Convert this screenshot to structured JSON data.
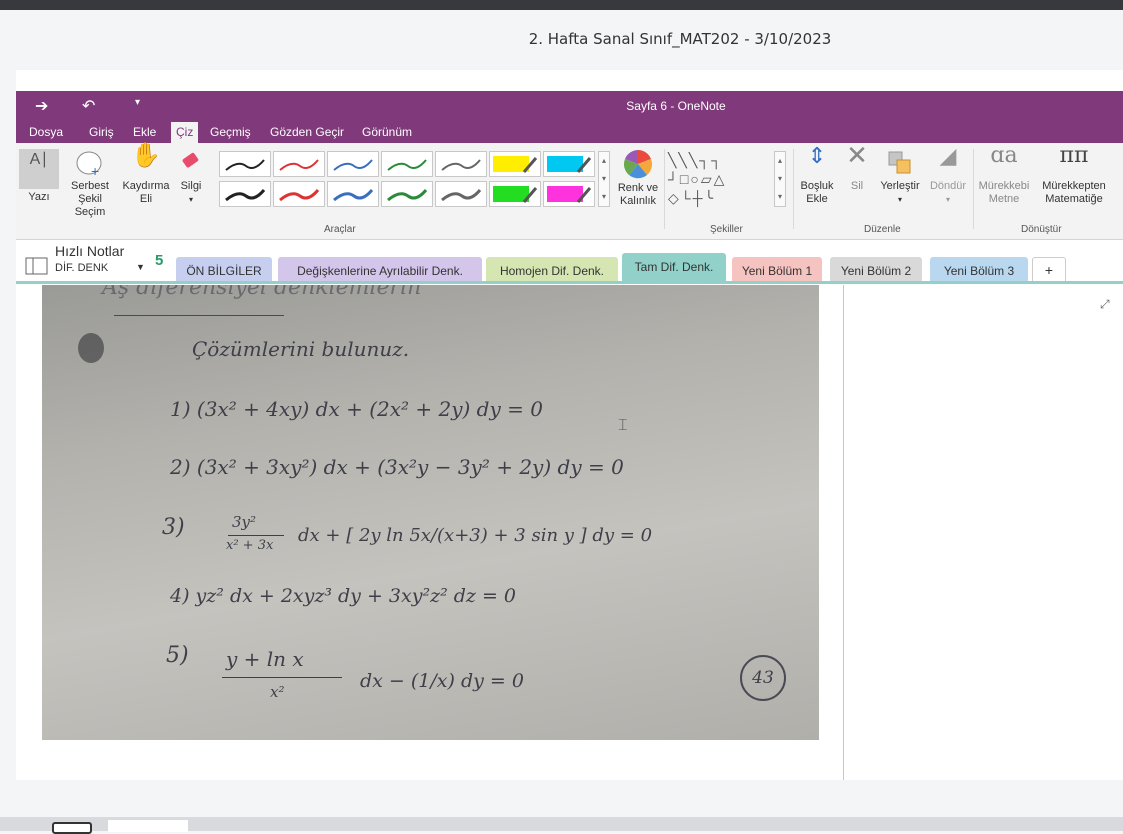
{
  "meeting": {
    "title": "2. Hafta Sanal Sınıf_MAT202 - 3/10/2023"
  },
  "window": {
    "title": "Sayfa 6 - OneNote"
  },
  "menu": [
    "Dosya",
    "Giriş",
    "Ekle",
    "Çiz",
    "Geçmiş",
    "Gözden Geçir",
    "Görünüm"
  ],
  "ribbon": {
    "yazi": "Yazı",
    "serbest_1": "Serbest",
    "serbest_2": "Şekil Seçim",
    "kaydirma_1": "Kaydırma",
    "kaydirma_2": "Eli",
    "silgi": "Silgi",
    "renk_1": "Renk ve",
    "renk_2": "Kalınlık",
    "bosluk_1": "Boşluk",
    "bosluk_2": "Ekle",
    "sil": "Sil",
    "yerlestir": "Yerleştir",
    "dondur": "Döndür",
    "murekkebi_1": "Mürekkebi",
    "murekkebi_2": "Metne",
    "murekkepten_1": "Mürekkepten",
    "murekkepten_2": "Matematiğe",
    "group_araclar": "Araçlar",
    "group_sekiller": "Şekiller",
    "group_duzenle": "Düzenle",
    "group_donustur": "Dönüştür"
  },
  "notebook": {
    "name": "Hızlı Notlar",
    "section": "DİF. DENK",
    "sync": "5"
  },
  "tabs": [
    {
      "label": "ÖN BİLGİLER",
      "color": "#c6cff0"
    },
    {
      "label": "Değişkenlerine Ayrılabilir Denk.",
      "color": "#d4c5ea"
    },
    {
      "label": "Homojen Dif. Denk.",
      "color": "#d5e6b3"
    },
    {
      "label": "Tam Dif. Denk.",
      "color": "#91d1c9"
    },
    {
      "label": "Yeni Bölüm 1",
      "color": "#f5c3c0"
    },
    {
      "label": "Yeni Bölüm 2",
      "color": "#d9d9d9"
    },
    {
      "label": "Yeni Bölüm 3",
      "color": "#b9d8f0"
    },
    {
      "label": "+",
      "color": "#ffffff"
    }
  ],
  "handwriting": {
    "header": "Aş diferensiyel denklemlerin",
    "instruction": "Çözümlerini bulunuz.",
    "eq1": "1)  (3x² + 4xy) dx + (2x² + 2y) dy = 0",
    "eq2": "2)  (3x² + 3xy²) dx + (3x²y − 3y² + 2y) dy = 0",
    "eq3_num": "3)",
    "eq3_frac_top": "3y²",
    "eq3_frac_bot": "x² + 3x",
    "eq3_rest": "dx + [ 2y ln 5x/(x+3) + 3 sin y ] dy = 0",
    "eq4": "4)  yz² dx + 2xyz³ dy + 3xy²z² dz = 0",
    "eq5_num": "5)",
    "eq5_frac_top": "y + ln x",
    "eq5_frac_bot": "x²",
    "eq5_rest": "dx − (1/x) dy = 0",
    "page_number": "43"
  }
}
